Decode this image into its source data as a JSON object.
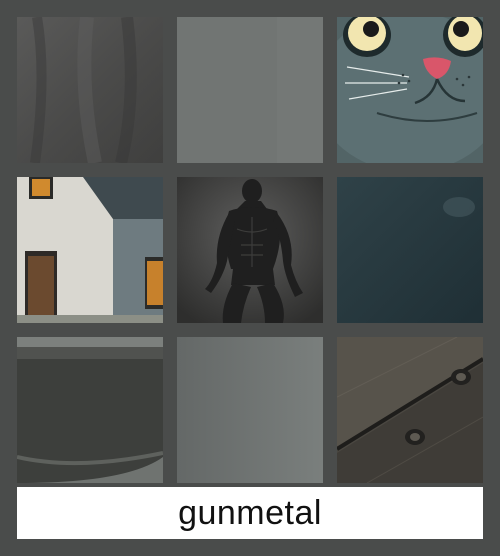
{
  "caption": "gunmetal",
  "colors": {
    "background": "#4a4c4b",
    "caption_background": "#ffffff",
    "caption_text": "#111111"
  },
  "tiles": [
    {
      "name": "fabric-tile"
    },
    {
      "name": "plain-gray-tile"
    },
    {
      "name": "cartoon-cat-tile"
    },
    {
      "name": "house-tile"
    },
    {
      "name": "muscular-figure-tile"
    },
    {
      "name": "dark-teal-tile"
    },
    {
      "name": "bowl-tile"
    },
    {
      "name": "gray-gradient-tile"
    },
    {
      "name": "wood-plank-tile"
    }
  ]
}
